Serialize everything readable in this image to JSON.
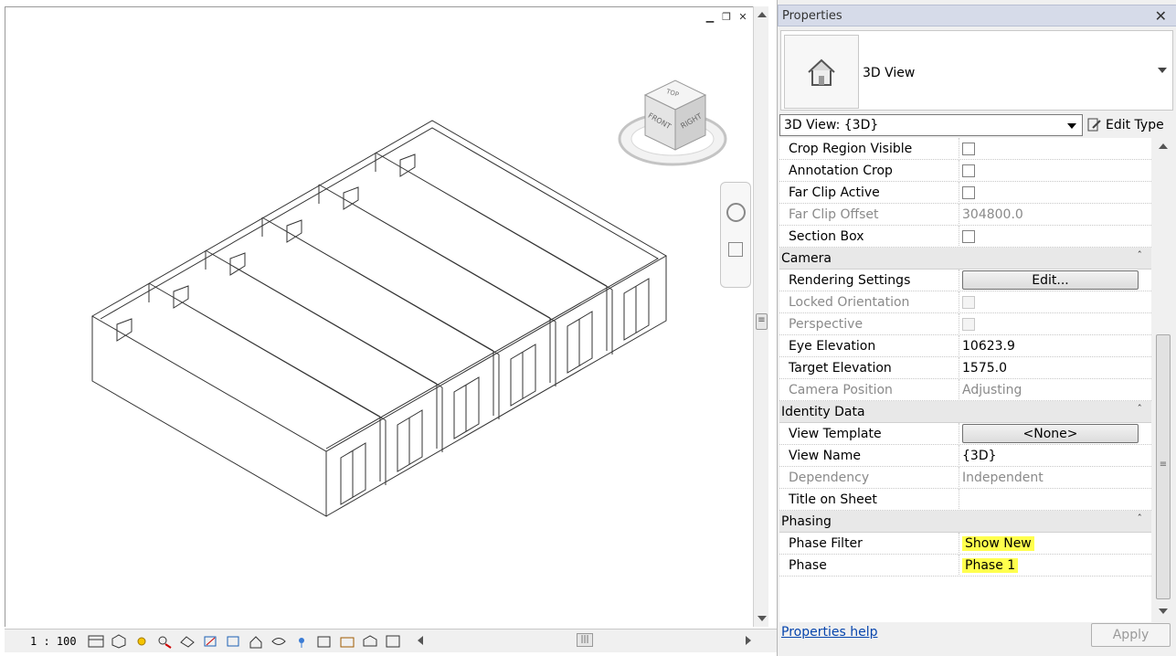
{
  "viewport": {
    "scale": "1 : 100",
    "viewcube": {
      "top": "TOP",
      "front": "FRONT",
      "right": "RIGHT"
    },
    "window_controls": [
      "minimize-icon",
      "restore-icon",
      "close-icon"
    ]
  },
  "properties": {
    "title": "Properties",
    "close": "✕",
    "type_name": "3D View",
    "view_selector": "3D View: {3D}",
    "edit_type": "Edit Type",
    "rows": [
      {
        "kind": "row",
        "label": "Crop Region Visible",
        "control": "checkbox",
        "disabled": false
      },
      {
        "kind": "row",
        "label": "Annotation Crop",
        "control": "checkbox",
        "disabled": false
      },
      {
        "kind": "row",
        "label": "Far Clip Active",
        "control": "checkbox",
        "disabled": false
      },
      {
        "kind": "row",
        "label": "Far Clip Offset",
        "control": "text",
        "value": "304800.0",
        "disabled": true
      },
      {
        "kind": "row",
        "label": "Section Box",
        "control": "checkbox",
        "disabled": false
      },
      {
        "kind": "group",
        "label": "Camera"
      },
      {
        "kind": "row",
        "label": "Rendering Settings",
        "control": "button",
        "value": "Edit...",
        "disabled": false
      },
      {
        "kind": "row",
        "label": "Locked Orientation",
        "control": "checkbox",
        "disabled": true
      },
      {
        "kind": "row",
        "label": "Perspective",
        "control": "checkbox",
        "disabled": true
      },
      {
        "kind": "row",
        "label": "Eye Elevation",
        "control": "text",
        "value": "10623.9",
        "disabled": false
      },
      {
        "kind": "row",
        "label": "Target Elevation",
        "control": "text",
        "value": "1575.0",
        "disabled": false
      },
      {
        "kind": "row",
        "label": "Camera Position",
        "control": "text",
        "value": "Adjusting",
        "disabled": true
      },
      {
        "kind": "group",
        "label": "Identity Data"
      },
      {
        "kind": "row",
        "label": "View Template",
        "control": "button",
        "value": "<None>",
        "disabled": false
      },
      {
        "kind": "row",
        "label": "View Name",
        "control": "text",
        "value": "{3D}",
        "disabled": false
      },
      {
        "kind": "row",
        "label": "Dependency",
        "control": "text",
        "value": "Independent",
        "disabled": true
      },
      {
        "kind": "row",
        "label": "Title on Sheet",
        "control": "text",
        "value": "",
        "disabled": false
      },
      {
        "kind": "group",
        "label": "Phasing"
      },
      {
        "kind": "row",
        "label": "Phase Filter",
        "control": "text",
        "value": "Show New",
        "highlight": true,
        "disabled": false
      },
      {
        "kind": "row",
        "label": "Phase",
        "control": "text",
        "value": "Phase 1",
        "highlight": true,
        "disabled": false
      }
    ],
    "help_link": "Properties help",
    "apply": "Apply",
    "highlight_color": "#ffff4d"
  }
}
